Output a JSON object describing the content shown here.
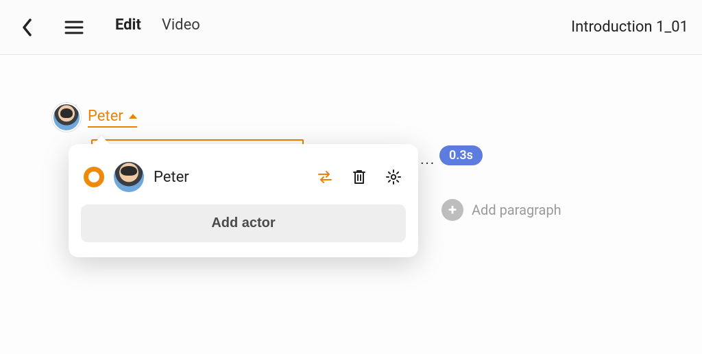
{
  "header": {
    "tabs": [
      {
        "label": "Edit",
        "active": true
      },
      {
        "label": "Video",
        "active": false
      }
    ],
    "project_title": "Introduction 1_01"
  },
  "editor": {
    "current_actor_name": "Peter",
    "dots": "....",
    "time_badge": "0.3s",
    "add_paragraph_label": "Add paragraph"
  },
  "actor_popover": {
    "items": [
      {
        "name": "Peter",
        "selected": true
      }
    ],
    "add_actor_label": "Add actor"
  }
}
